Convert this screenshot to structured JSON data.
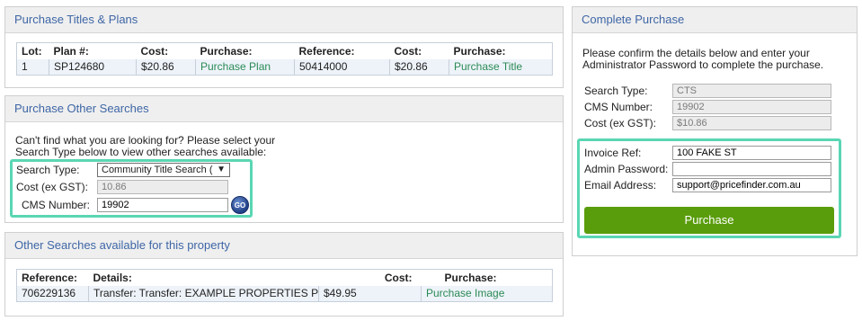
{
  "panels": {
    "titles": {
      "title": "Purchase Titles & Plans",
      "headers": [
        "Lot:",
        "Plan #:",
        "Cost:",
        "Purchase:",
        "Reference:",
        "Cost:",
        "Purchase:"
      ],
      "row": {
        "lot": "1",
        "plan": "SP124680",
        "plan_cost": "$20.86",
        "plan_purchase": "Purchase Plan",
        "reference": "50414000",
        "title_cost": "$20.86",
        "title_purchase": "Purchase Title"
      }
    },
    "other_searches": {
      "title": "Purchase Other Searches",
      "description_line1": "Can't find what you are looking for? Please select your",
      "description_line2": "Search Type below to view other searches available:",
      "search_type_label": "Search Type:",
      "search_type_value": "Community Title Search (",
      "cost_label": "Cost (ex GST):",
      "cost_value": "10.86",
      "cms_label": "CMS Number:",
      "cms_value": "19902",
      "go_label": "GO"
    },
    "available": {
      "title": "Other Searches available for this property",
      "headers": [
        "Reference:",
        "Details:",
        "Cost:",
        "Purchase:"
      ],
      "row": {
        "reference": "706229136",
        "details": "Transfer: Transfer: EXAMPLE PROPERTIES PT'",
        "cost": "$49.95",
        "purchase": "Purchase Image"
      }
    },
    "complete": {
      "title": "Complete Purchase",
      "description_line1": "Please confirm the details below and enter your",
      "description_line2": "Administrator Password to complete the purchase.",
      "search_type_label": "Search Type:",
      "search_type_value": "CTS",
      "cms_label": "CMS Number:",
      "cms_value": "19902",
      "cost_label": "Cost (ex GST):",
      "cost_value": "$10.86",
      "invoice_label": "Invoice Ref:",
      "invoice_value": "100 FAKE ST",
      "password_label": "Admin Password:",
      "password_value": "",
      "email_label": "Email Address:",
      "email_value": "support@pricefinder.com.au",
      "button_label": "Purchase"
    }
  },
  "colors": {
    "header_text": "#3e66a6",
    "link": "#2a8a55",
    "highlight": "#5ad6b3",
    "purchase_button": "#5a9d0c"
  }
}
